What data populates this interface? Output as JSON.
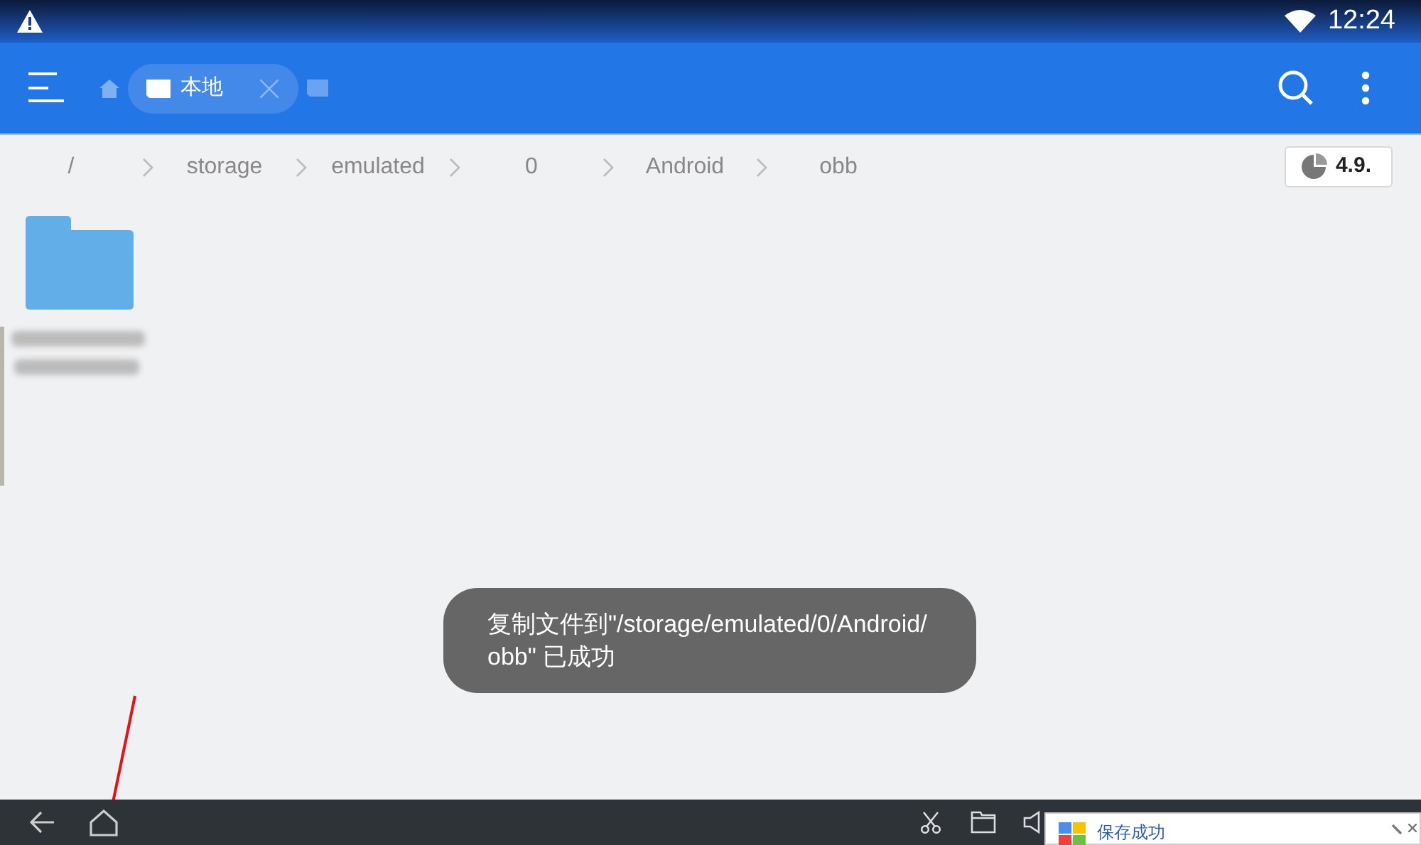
{
  "status_bar": {
    "time": "12:24"
  },
  "toolbar": {
    "tabs": [
      {
        "label": "本地",
        "selected": true
      }
    ]
  },
  "breadcrumbs": [
    "/",
    "storage",
    "emulated",
    "0",
    "Android",
    "obb"
  ],
  "storage_badge": "4.9.",
  "files": [
    {
      "kind": "folder"
    }
  ],
  "toast": {
    "lines": [
      "复制文件到\"/storage/emulated/0/Android/",
      "obb\" 已成功"
    ]
  },
  "notification": {
    "text": "保存成功"
  }
}
